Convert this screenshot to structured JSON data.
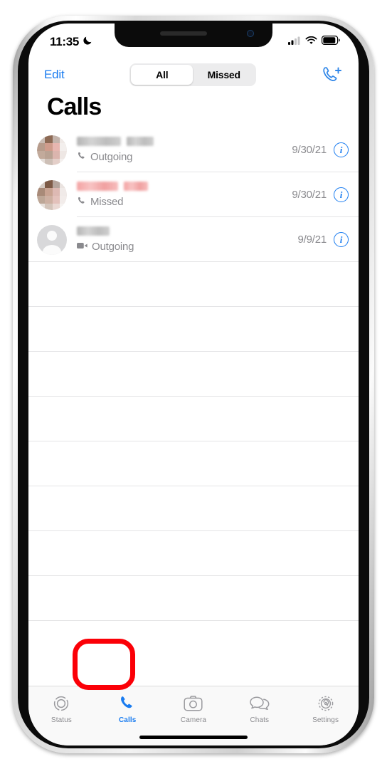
{
  "status_bar": {
    "time": "11:35",
    "dnd_icon": "crescent-moon-icon",
    "signal_icon": "cellular-signal-icon",
    "wifi_icon": "wifi-icon",
    "battery_icon": "battery-icon"
  },
  "nav": {
    "edit_label": "Edit",
    "new_call_icon": "phone-plus-icon",
    "segments": [
      {
        "label": "All",
        "selected": true
      },
      {
        "label": "Missed",
        "selected": false
      }
    ]
  },
  "title": "Calls",
  "calls": [
    {
      "avatar": "photo-avatar-blurred",
      "name_redacted": true,
      "name_color": "#c0c0c0",
      "type_icon": "phone-handset-icon",
      "type_label": "Outgoing",
      "date": "9/30/21",
      "info_label": "i"
    },
    {
      "avatar": "photo-avatar-blurred",
      "name_redacted": true,
      "name_color": "#f2a8a8",
      "type_icon": "phone-handset-icon",
      "type_label": "Missed",
      "date": "9/30/21",
      "info_label": "i"
    },
    {
      "avatar": "default-person-avatar",
      "name_redacted": true,
      "name_color": "#c0c0c0",
      "type_icon": "video-camera-icon",
      "type_label": "Outgoing",
      "date": "9/9/21",
      "info_label": "i"
    }
  ],
  "empty_row_count": 8,
  "tabs": [
    {
      "label": "Status",
      "icon": "status-rings-icon",
      "active": false
    },
    {
      "label": "Calls",
      "icon": "phone-handset-icon",
      "active": true
    },
    {
      "label": "Camera",
      "icon": "camera-icon",
      "active": false
    },
    {
      "label": "Chats",
      "icon": "chat-bubbles-icon",
      "active": false
    },
    {
      "label": "Settings",
      "icon": "gear-icon",
      "active": false
    }
  ],
  "annotation": {
    "shape": "rounded-rectangle-highlight",
    "color": "#fb0007",
    "target": "Calls"
  },
  "colors": {
    "accent_blue": "#1a7cf0",
    "annotation_red": "#fb0007",
    "secondary_text": "#8a8a8e"
  }
}
